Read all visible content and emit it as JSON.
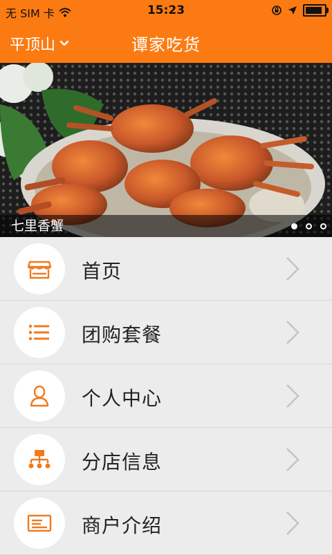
{
  "status_bar": {
    "carrier": "无 SIM 卡",
    "time": "15:23",
    "battery_level": 0.9
  },
  "navbar": {
    "city": "平顶山",
    "title": "谭家吃货"
  },
  "banner": {
    "caption": "七里香蟹",
    "slides_count": 3,
    "active_slide": 1
  },
  "menu": {
    "items": [
      {
        "label": "首页",
        "icon": "storefront-icon"
      },
      {
        "label": "团购套餐",
        "icon": "list-icon"
      },
      {
        "label": "个人中心",
        "icon": "person-icon"
      },
      {
        "label": "分店信息",
        "icon": "branch-network-icon"
      },
      {
        "label": "商户介绍",
        "icon": "id-card-icon"
      }
    ]
  },
  "colors": {
    "accent": "#fb7b12",
    "background": "#ececec"
  }
}
